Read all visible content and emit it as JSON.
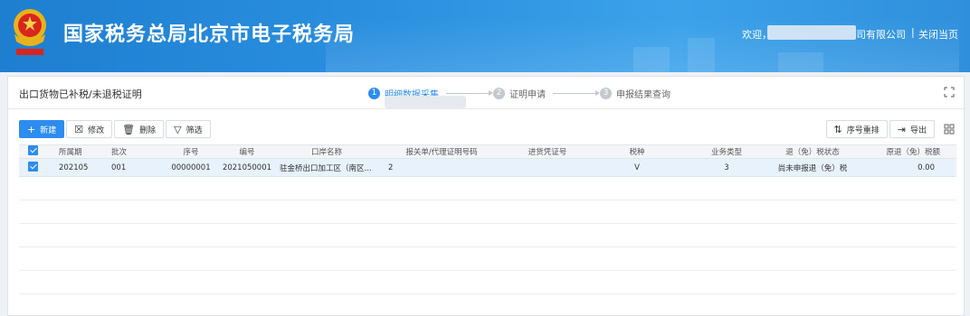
{
  "header": {
    "title": "国家税务总局北京市电子税务局",
    "welcome": "欢迎，",
    "company_suffix": "司有限公司",
    "separator": "|",
    "close_label": "关闭当页",
    "brand_color": "#1e7ed0"
  },
  "panel": {
    "title": "出口货物已补税/未退税证明",
    "steps": [
      {
        "num": "1",
        "label": "明细数据采集",
        "active": true
      },
      {
        "num": "2",
        "label": "证明申请",
        "active": false
      },
      {
        "num": "3",
        "label": "申报结果查询",
        "active": false
      }
    ],
    "expand_icon": "expand-icon"
  },
  "toolbar": {
    "add": {
      "icon": "+",
      "label": "新建"
    },
    "edit": {
      "icon": "☒",
      "label": "修改"
    },
    "delete": {
      "icon": "🗑",
      "label": "删除"
    },
    "filter": {
      "icon": "▽",
      "label": "筛选"
    },
    "reorder": {
      "icon": "⇅",
      "label": "序号重排"
    },
    "export": {
      "icon": "⇥",
      "label": "导出"
    }
  },
  "table": {
    "columns": [
      "所属期",
      "批次",
      "序号",
      "编号",
      "口岸名称",
      "报关单/代理证明号码",
      "进货凭证号",
      "税种",
      "业务类型",
      "退（免）税状态",
      "原退（免）税额"
    ],
    "rows": [
      {
        "period": "202105",
        "batch": "001",
        "seq": "00000001",
        "number": "2021050001",
        "port": "驻金桥出口加工区（南区...",
        "customs_no": "2",
        "voucher_no": "",
        "tax_type": "V",
        "biz_type": "3",
        "status": "尚未申报退（免）税",
        "amount": "0.00",
        "selected": true
      }
    ]
  }
}
